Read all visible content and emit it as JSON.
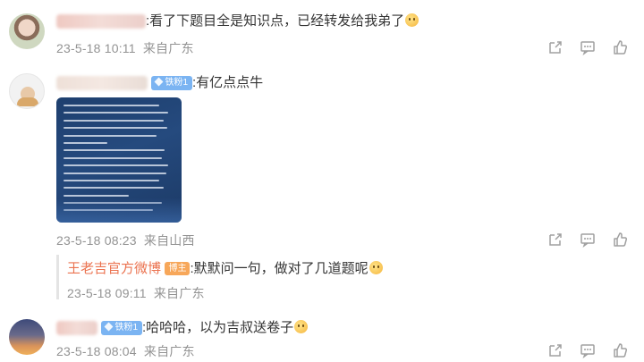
{
  "comments": [
    {
      "text": ":看了下题目全是知识点，已经转发给我弟了",
      "date": "23-5-18 10:11",
      "location": "来自广东",
      "emoji": "smile-emoji"
    },
    {
      "badge": "铁粉1",
      "text": ":有亿点点牛",
      "date": "23-5-18 08:23",
      "location": "来自山西",
      "has_image": true,
      "reply": {
        "author": "王老吉官方微博",
        "author_badge": "博主",
        "text": ":默默问一句，做对了几道题呢",
        "date": "23-5-18 09:11",
        "location": "来自广东"
      }
    },
    {
      "badge": "铁粉1",
      "text": ":哈哈哈，以为吉叔送卷子",
      "date": "23-5-18 08:04",
      "location": "来自广东",
      "emoji": "laugh-emoji"
    }
  ],
  "icons": {
    "share": "share-icon",
    "comment": "comment-icon",
    "like": "like-icon"
  },
  "colors": {
    "name_link": "#eb7350",
    "meta": "#939393",
    "badge_blue": "#7bb4f2",
    "badge_orange": "#f7a75a"
  }
}
